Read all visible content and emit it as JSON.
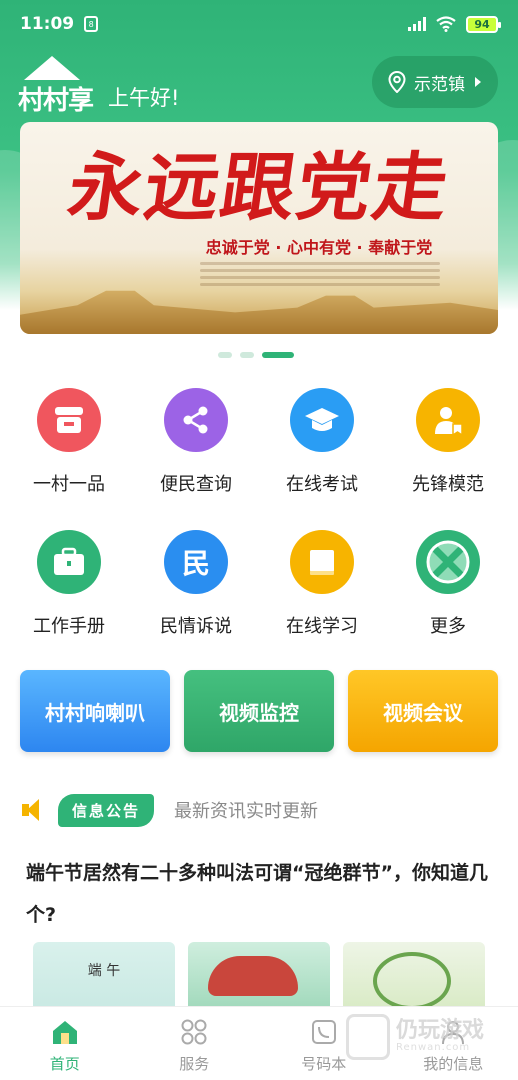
{
  "status": {
    "time": "11:09",
    "sim": "8",
    "battery": "94"
  },
  "header": {
    "greeting": "上午好!",
    "logo_text": "村村享",
    "location": "示范镇"
  },
  "banner": {
    "title": "永远跟党走",
    "slogan": "忠诚于党 · 心中有党 · 奉献于党"
  },
  "grid": [
    {
      "label": "一村一品",
      "color": "#f0565e",
      "icon": "shop-icon"
    },
    {
      "label": "便民查询",
      "color": "#9c63e6",
      "icon": "share-icon"
    },
    {
      "label": "在线考试",
      "color": "#2a9df4",
      "icon": "graduation-cap-icon"
    },
    {
      "label": "先锋模范",
      "color": "#f7b400",
      "icon": "badge-person-icon"
    },
    {
      "label": "工作手册",
      "color": "#2fb377",
      "icon": "briefcase-icon"
    },
    {
      "label": "民情诉说",
      "color": "#2a8ef0",
      "icon": "min-character-icon",
      "glyph": "民"
    },
    {
      "label": "在线学习",
      "color": "#f7b400",
      "icon": "book-icon"
    },
    {
      "label": "更多",
      "color": "#2fb377",
      "icon": "more-icon"
    }
  ],
  "quick_buttons": [
    {
      "label": "村村响喇叭",
      "color_from": "#5ab6ff",
      "color_to": "#2d86f0"
    },
    {
      "label": "视频监控",
      "color_from": "#45c07f",
      "color_to": "#2fa668"
    },
    {
      "label": "视频会议",
      "color_from": "#ffc727",
      "color_to": "#f5a500"
    }
  ],
  "notice": {
    "tag": "信息公告",
    "text": "最新资讯实时更新"
  },
  "article": {
    "title": "端午节居然有二十多种叫法可谓“冠绝群节”，你知道几个?",
    "thumb1_text": "端 午"
  },
  "tabbar": [
    {
      "label": "首页"
    },
    {
      "label": "服务"
    },
    {
      "label": "号码本"
    },
    {
      "label": "我的信息"
    }
  ],
  "watermark": {
    "text": "仍玩游戏",
    "sub": "Renwan.com"
  }
}
